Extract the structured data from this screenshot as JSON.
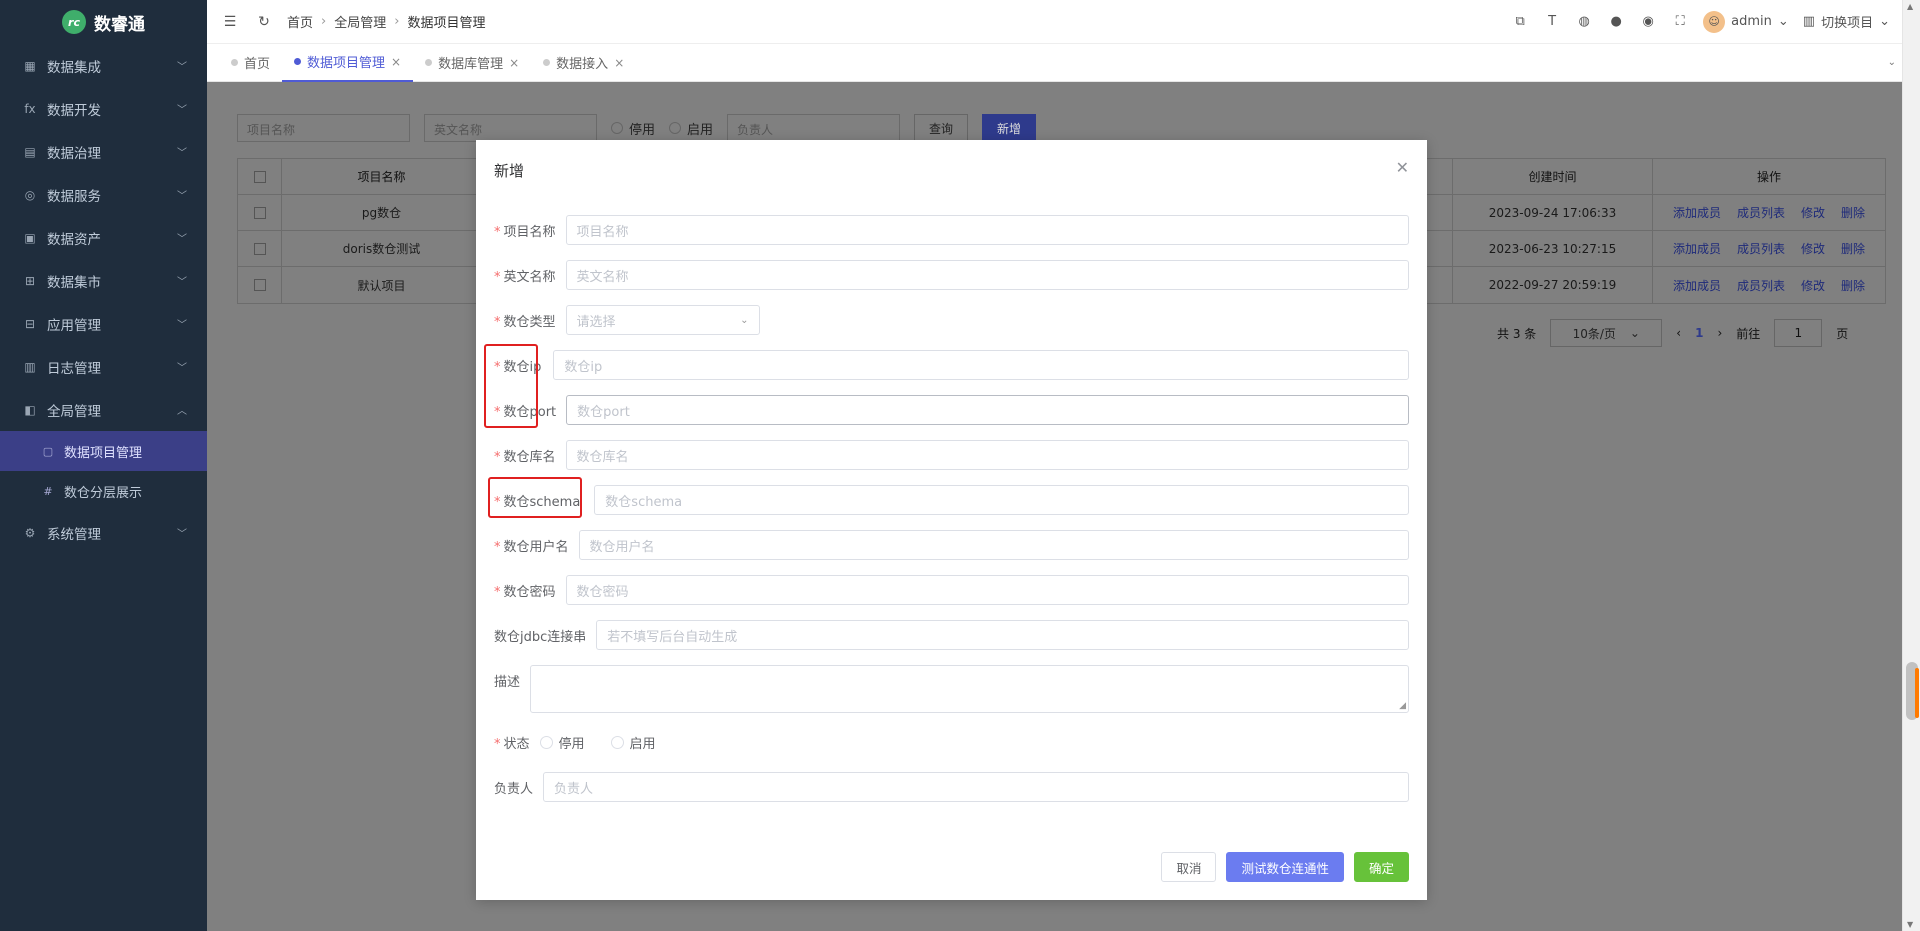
{
  "app": {
    "name": "数睿通"
  },
  "sidebar": {
    "items": [
      {
        "label": "数据集成",
        "icon": "▦",
        "icon_name": "database-icon",
        "expanded": false
      },
      {
        "label": "数据开发",
        "icon": "fx",
        "icon_name": "function-icon",
        "expanded": false
      },
      {
        "label": "数据治理",
        "icon": "▤",
        "icon_name": "governance-icon",
        "expanded": false
      },
      {
        "label": "数据服务",
        "icon": "◎",
        "icon_name": "service-icon",
        "expanded": false
      },
      {
        "label": "数据资产",
        "icon": "▣",
        "icon_name": "asset-icon",
        "expanded": false
      },
      {
        "label": "数据集市",
        "icon": "⊞",
        "icon_name": "market-icon",
        "expanded": false
      },
      {
        "label": "应用管理",
        "icon": "⊟",
        "icon_name": "app-icon",
        "expanded": false
      },
      {
        "label": "日志管理",
        "icon": "▥",
        "icon_name": "log-icon",
        "expanded": false
      },
      {
        "label": "全局管理",
        "icon": "◧",
        "icon_name": "global-icon",
        "expanded": true
      },
      {
        "label": "系统管理",
        "icon": "⚙",
        "icon_name": "gear-icon",
        "expanded": false
      }
    ],
    "submenu": [
      {
        "label": "数据项目管理",
        "icon": "▢",
        "active": true
      },
      {
        "label": "数仓分层展示",
        "icon": "#",
        "active": false
      }
    ]
  },
  "topbar": {
    "breadcrumb": [
      "首页",
      "全局管理",
      "数据项目管理"
    ],
    "user": "admin",
    "switch_label": "切换项目"
  },
  "tabs": [
    {
      "label": "首页",
      "active": false,
      "closable": false
    },
    {
      "label": "数据项目管理",
      "active": true,
      "closable": true
    },
    {
      "label": "数据库管理",
      "active": false,
      "closable": true
    },
    {
      "label": "数据接入",
      "active": false,
      "closable": true
    }
  ],
  "filters": {
    "project_name_placeholder": "项目名称",
    "english_name_placeholder": "英文名称",
    "radio_disabled": "停用",
    "radio_enabled": "启用",
    "owner_placeholder": "负责人",
    "query_label": "查询",
    "add_label": "新增"
  },
  "table": {
    "headers": {
      "name": "项目名称",
      "created": "创建时间",
      "ops": "操作"
    },
    "rows": [
      {
        "name": "pg数仓",
        "created": "2023-09-24 17:06:33"
      },
      {
        "name": "doris数仓测试",
        "created": "2023-06-23 10:27:15"
      },
      {
        "name": "默认项目",
        "created": "2022-09-27 20:59:19"
      }
    ],
    "ops": [
      "添加成员",
      "成员列表",
      "修改",
      "删除"
    ]
  },
  "pagination": {
    "total": "共 3 条",
    "page_size": "10条/页",
    "current_page": "1",
    "goto_label": "前往",
    "goto_value": "1",
    "page_suffix": "页"
  },
  "modal": {
    "title": "新增",
    "fields": {
      "project_name": {
        "label": "项目名称",
        "placeholder": "项目名称",
        "required": true
      },
      "english_name": {
        "label": "英文名称",
        "placeholder": "英文名称",
        "required": true
      },
      "warehouse_type": {
        "label": "数仓类型",
        "placeholder": "请选择",
        "required": true
      },
      "warehouse_ip": {
        "label": "数仓ip",
        "placeholder": "数仓ip",
        "required": true
      },
      "warehouse_port": {
        "label": "数仓port",
        "placeholder": "数仓port",
        "required": true
      },
      "warehouse_db": {
        "label": "数仓库名",
        "placeholder": "数仓库名",
        "required": true
      },
      "warehouse_schema": {
        "label": "数仓schema",
        "placeholder": "数仓schema",
        "required": true
      },
      "warehouse_user": {
        "label": "数仓用户名",
        "placeholder": "数仓用户名",
        "required": true
      },
      "warehouse_password": {
        "label": "数仓密码",
        "placeholder": "数仓密码",
        "required": true
      },
      "jdbc_url": {
        "label": "数仓jdbc连接串",
        "placeholder": "若不填写后台自动生成",
        "required": false
      },
      "description": {
        "label": "描述",
        "required": false
      },
      "status": {
        "label": "状态",
        "required": true,
        "options": [
          "停用",
          "启用"
        ]
      },
      "owner": {
        "label": "负责人",
        "placeholder": "负责人",
        "required": false
      }
    },
    "buttons": {
      "cancel": "取消",
      "test": "测试数仓连通性",
      "ok": "确定"
    }
  },
  "colors": {
    "sidebar_bg": "#1f2d3d",
    "accent": "#4f5bd5",
    "highlight_box": "#e02020",
    "ok_button": "#67c23a",
    "test_button": "#6b7cf0"
  }
}
